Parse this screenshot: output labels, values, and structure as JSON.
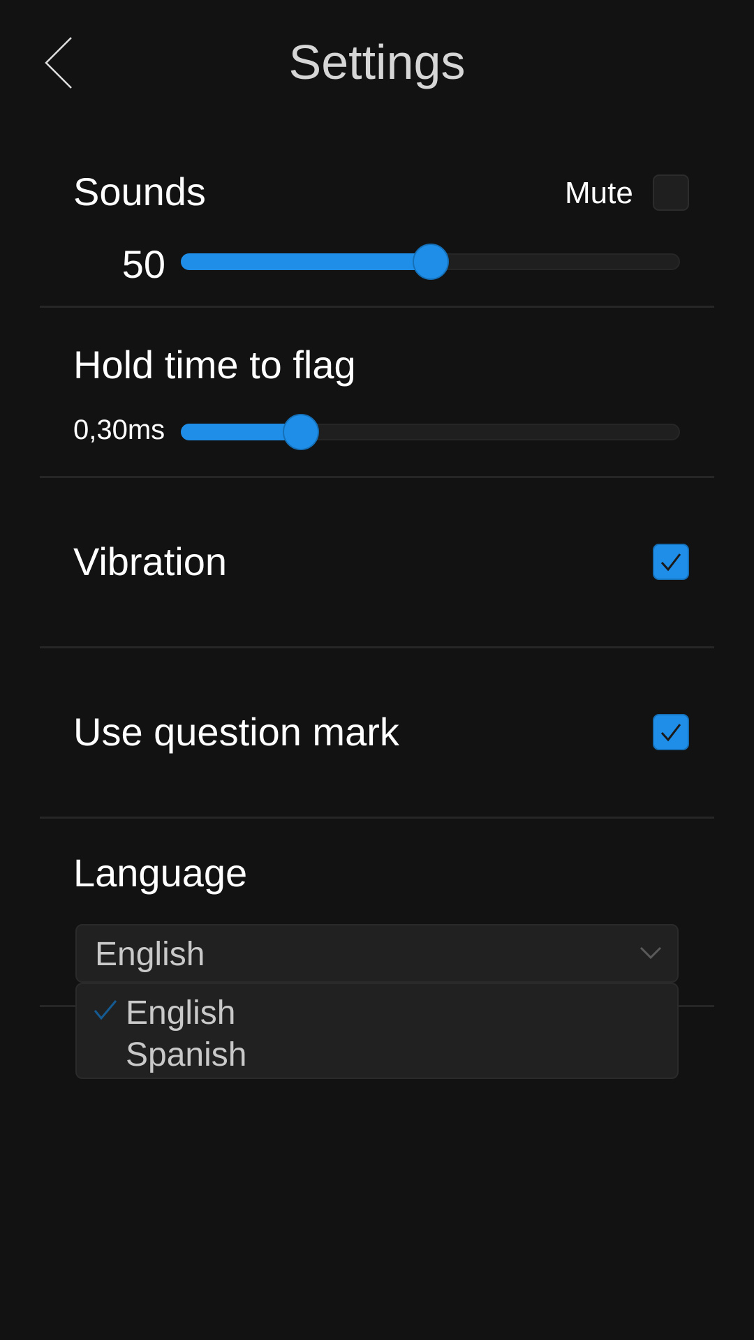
{
  "header": {
    "title": "Settings",
    "back_icon": "chevron-left-icon"
  },
  "sounds": {
    "label": "Sounds",
    "mute_label": "Mute",
    "mute_checked": false,
    "volume_display": "50",
    "volume_value": 50,
    "volume_max": 100
  },
  "hold_time": {
    "label": "Hold time to flag",
    "value_display": "0,30ms",
    "value_fraction": 0.22
  },
  "vibration": {
    "label": "Vibration",
    "checked": true
  },
  "question_mark": {
    "label": "Use question mark",
    "checked": true
  },
  "language": {
    "label": "Language",
    "selected": "English",
    "options": [
      "English",
      "Spanish"
    ]
  },
  "colors": {
    "accent": "#1e8ee8",
    "background": "#121212",
    "divider": "#262626"
  }
}
